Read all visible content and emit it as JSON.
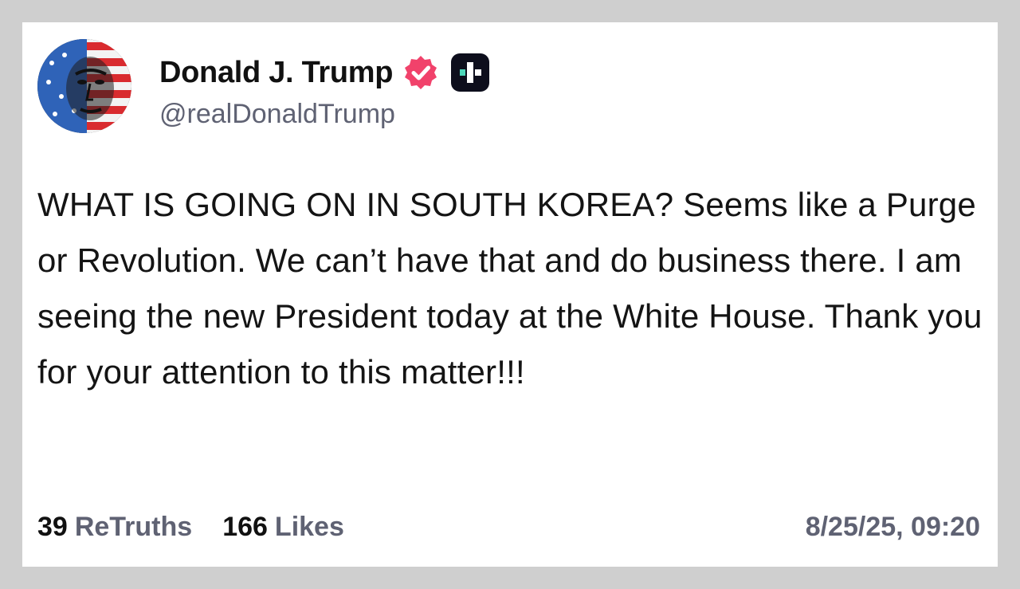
{
  "post": {
    "author": {
      "display_name": "Donald J. Trump",
      "handle": "@realDonaldTrump",
      "verified": true
    },
    "text": "WHAT IS GOING ON IN SOUTH KOREA? Seems like a Purge or Revolution. We can’t have that and do business there. I am seeing the new President today at the White House. Thank you for your attention to this matter!!!",
    "stats": {
      "retruths_count": "39",
      "retruths_label": "ReTruths",
      "likes_count": "166",
      "likes_label": "Likes"
    },
    "timestamp": "8/25/25, 09:20"
  },
  "icons": {
    "verified": "verified-badge-icon",
    "platform": "truth-social-logo-icon"
  },
  "colors": {
    "background": "#cfcfcf",
    "card": "#ffffff",
    "verified_badge": "#f1426b",
    "muted_text": "#5f6273",
    "platform_logo_accent": "#4cd6b9"
  }
}
